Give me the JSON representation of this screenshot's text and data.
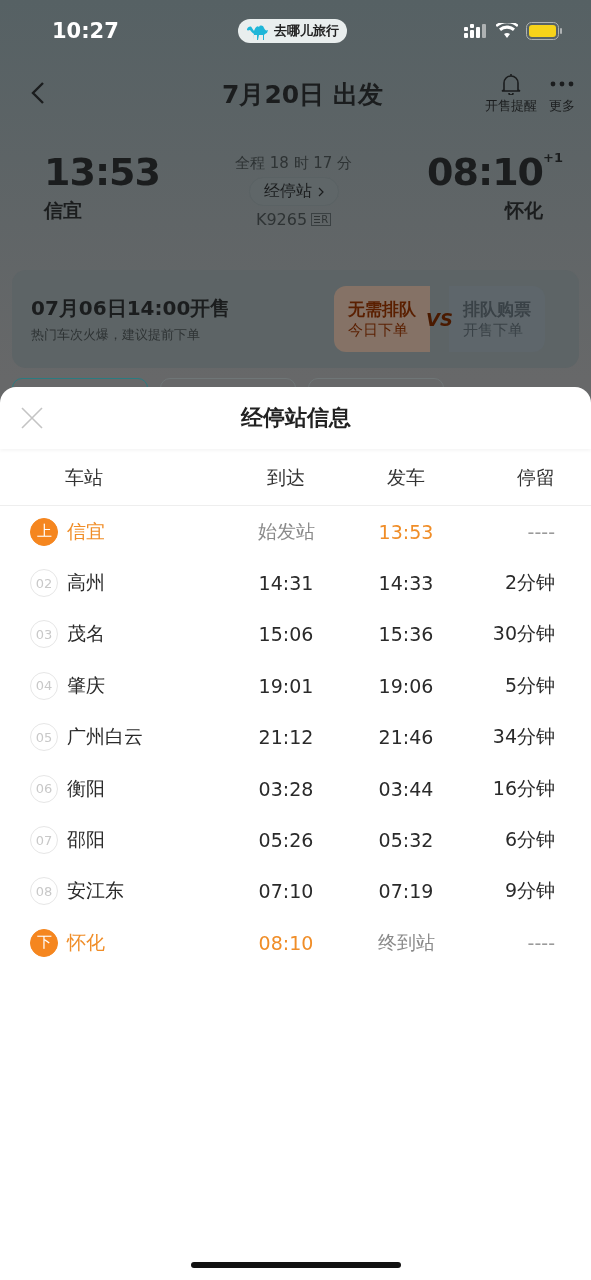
{
  "status_bar": {
    "time": "10:27",
    "app_pill": "去哪儿旅行"
  },
  "nav": {
    "title": "7月20日 出发",
    "actions": [
      {
        "kind": "bell",
        "label": "开售提醒"
      },
      {
        "kind": "more",
        "label": "更多"
      }
    ]
  },
  "journey": {
    "depart_time": "13:53",
    "depart_station": "信宜",
    "duration": "全程 18 时 17 分",
    "stops_button": "经停站",
    "train_no": "K9265",
    "train_badge": "R",
    "arrive_time": "08:10",
    "day_offset": "+1",
    "arrive_station": "怀化"
  },
  "sale": {
    "title": "07月06日14:00开售",
    "note": "热门车次火爆，建议提前下单",
    "option_a": {
      "title": "无需排队",
      "sub": "今日下单"
    },
    "vs": "VS",
    "option_b": {
      "title": "排队购票",
      "sub": "开售下单"
    }
  },
  "filter_tabs": [
    {
      "selected": true
    },
    {
      "selected": false
    },
    {
      "selected": false
    }
  ],
  "sheet": {
    "title": "经停站信息",
    "columns": [
      "车站",
      "到达",
      "发车",
      "停留"
    ],
    "stops": [
      {
        "kind": "origin",
        "badge": "上",
        "station": "信宜",
        "arrive": "始发站",
        "depart": "13:53",
        "stay": "----"
      },
      {
        "kind": "middle",
        "badge": "02",
        "station": "高州",
        "arrive": "14:31",
        "depart": "14:33",
        "stay": "2分钟"
      },
      {
        "kind": "middle",
        "badge": "03",
        "station": "茂名",
        "arrive": "15:06",
        "depart": "15:36",
        "stay": "30分钟"
      },
      {
        "kind": "middle",
        "badge": "04",
        "station": "肇庆",
        "arrive": "19:01",
        "depart": "19:06",
        "stay": "5分钟"
      },
      {
        "kind": "middle",
        "badge": "05",
        "station": "广州白云",
        "arrive": "21:12",
        "depart": "21:46",
        "stay": "34分钟"
      },
      {
        "kind": "middle",
        "badge": "06",
        "station": "衡阳",
        "arrive": "03:28",
        "depart": "03:44",
        "stay": "16分钟"
      },
      {
        "kind": "middle",
        "badge": "07",
        "station": "邵阳",
        "arrive": "05:26",
        "depart": "05:32",
        "stay": "6分钟"
      },
      {
        "kind": "middle",
        "badge": "08",
        "station": "安江东",
        "arrive": "07:10",
        "depart": "07:19",
        "stay": "9分钟"
      },
      {
        "kind": "terminal",
        "badge": "下",
        "station": "怀化",
        "arrive": "08:10",
        "depart": "终到站",
        "stay": "----"
      }
    ]
  }
}
